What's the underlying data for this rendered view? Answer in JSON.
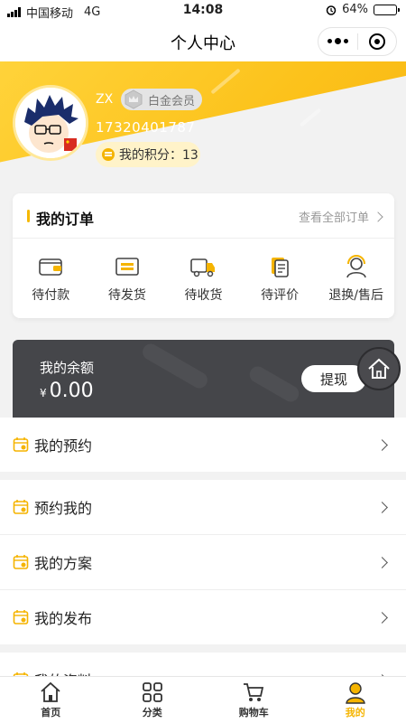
{
  "status_bar": {
    "carrier": "中国移动",
    "network": "4G",
    "time": "14:08",
    "battery": "64%",
    "battery_level": 0.64
  },
  "nav": {
    "title": "个人中心"
  },
  "user": {
    "name": "ZX",
    "membership": "白金会员",
    "phone": "17320401787",
    "points_label": "我的积分：",
    "points": "13"
  },
  "orders": {
    "title": "我的订单",
    "view_all": "查看全部订单",
    "items": [
      {
        "label": "待付款",
        "icon": "wallet-icon"
      },
      {
        "label": "待发货",
        "icon": "package-icon"
      },
      {
        "label": "待收货",
        "icon": "truck-icon"
      },
      {
        "label": "待评价",
        "icon": "review-icon"
      },
      {
        "label": "退换/售后",
        "icon": "service-icon"
      }
    ]
  },
  "balance": {
    "label": "我的余额",
    "currency": "¥",
    "amount": "0.00",
    "withdraw": "提现"
  },
  "menu": [
    {
      "label": "我的预约",
      "icon": "calendar-icon"
    },
    {
      "label": "预约我的",
      "icon": "calendar-icon"
    },
    {
      "label": "我的方案",
      "icon": "calendar-icon"
    },
    {
      "label": "我的发布",
      "icon": "calendar-icon"
    },
    {
      "label": "我的资料",
      "icon": "calendar-icon"
    }
  ],
  "tabs": [
    {
      "label": "首页",
      "icon": "home-icon"
    },
    {
      "label": "分类",
      "icon": "category-icon"
    },
    {
      "label": "购物车",
      "icon": "cart-icon"
    },
    {
      "label": "我的",
      "icon": "user-icon",
      "active": true
    }
  ],
  "colors": {
    "accent": "#f5b400",
    "header": "#fcc21b",
    "balance_bg": "#45464a"
  }
}
